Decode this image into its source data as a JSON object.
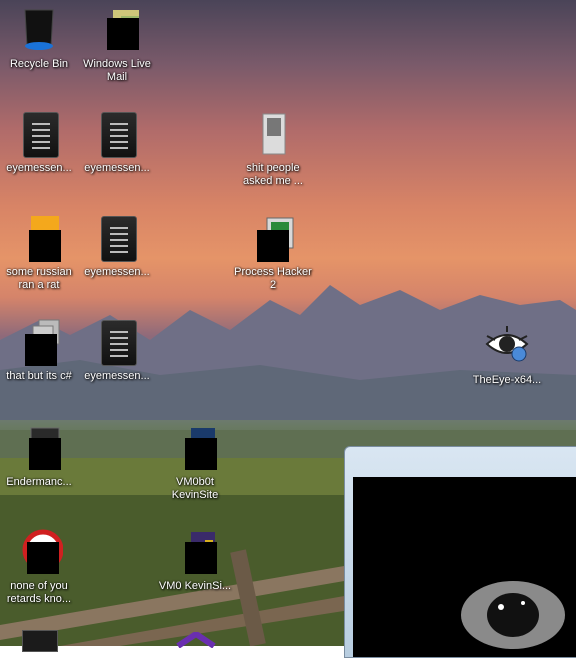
{
  "desktop": {
    "icons": [
      {
        "label": "Recycle Bin",
        "icon": "recycle-bin-icon"
      },
      {
        "label": "Windows Live Mail",
        "icon": "mail-folder-icon"
      },
      {
        "label": "eyemessen...",
        "icon": "document-icon"
      },
      {
        "label": "eyemessen...",
        "icon": "document-icon"
      },
      {
        "label": "shit people asked me ...",
        "icon": "folder-icon"
      },
      {
        "label": "some russian ran a rat",
        "icon": "app-icon"
      },
      {
        "label": "eyemessen...",
        "icon": "document-icon"
      },
      {
        "label": "Process Hacker 2",
        "icon": "process-hacker-icon"
      },
      {
        "label": "that but its c#",
        "icon": "stacked-files-icon"
      },
      {
        "label": "eyemessen...",
        "icon": "document-icon"
      },
      {
        "label": "TheEye-x64...",
        "icon": "eye-icon"
      },
      {
        "label": "Endermanc...",
        "icon": "app-icon"
      },
      {
        "label": "VM0b0t KevinSite",
        "icon": "vm-icon"
      },
      {
        "label": "none of you retards kno...",
        "icon": "app-icon"
      },
      {
        "label": "VM0 KevinSi...",
        "icon": "vm-icon"
      }
    ]
  },
  "colors": {
    "accent": "#0078d7",
    "window_frame": "#b8cde0"
  }
}
